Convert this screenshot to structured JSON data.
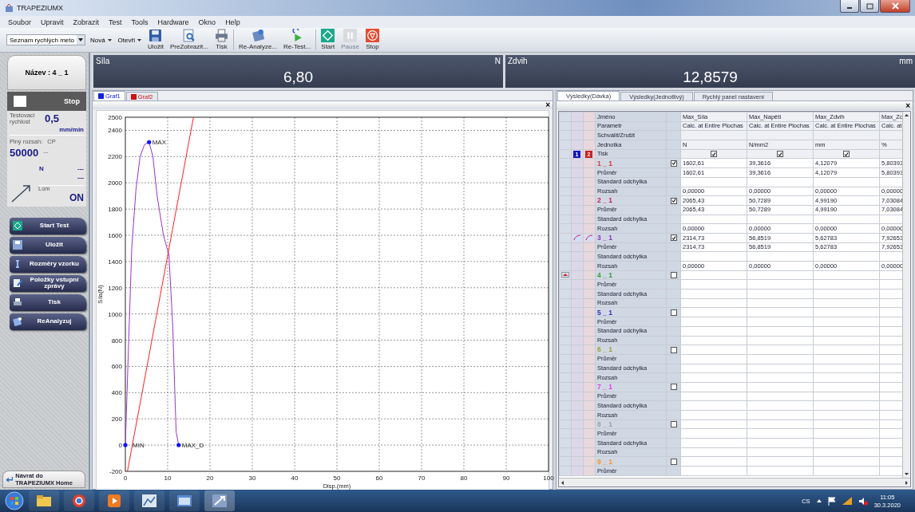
{
  "window": {
    "title": "TRAPEZIUMX"
  },
  "menu": [
    "Soubor",
    "Upravit",
    "Zobrazit",
    "Test",
    "Tools",
    "Hardware",
    "Okno",
    "Help"
  ],
  "toolbar": {
    "quick_methods": "Seznam rychlých meto",
    "menus": [
      "Nová",
      "Otevři"
    ],
    "buttons": [
      {
        "label": "Uložit",
        "kind": "save",
        "disabled": false
      },
      {
        "label": "PreZobrazit...",
        "kind": "preview",
        "disabled": false
      },
      {
        "label": "Tisk",
        "kind": "print",
        "disabled": false
      },
      {
        "label": "Re-Analyze...",
        "kind": "reanalyze",
        "disabled": false
      },
      {
        "label": "Re-Test...",
        "kind": "retest",
        "disabled": false
      },
      {
        "label": "Start",
        "kind": "start",
        "disabled": false
      },
      {
        "label": "Pause",
        "kind": "pause",
        "disabled": true
      },
      {
        "label": "Stop",
        "kind": "stop",
        "disabled": false
      }
    ]
  },
  "left_panel": {
    "name": "Název : 4 _ 1",
    "status": "Stop",
    "speed": {
      "label": "Testovací rychlost",
      "value": "0,5",
      "unit": "mm/min"
    },
    "range": {
      "label": "Plný rozsah:",
      "mode": "CP",
      "mode_reading": "---",
      "value": "50000",
      "unit": "N",
      "reading": "---",
      "reading_unit": "—"
    },
    "break": {
      "label": "Lom",
      "value": "ON"
    },
    "actions": [
      {
        "label": "Start Test",
        "kind": "start"
      },
      {
        "label": "Uložit",
        "kind": "save"
      },
      {
        "label": "Rozměry vzorku",
        "kind": "dimensions"
      },
      {
        "label": "Položky vstupní zprávy",
        "kind": "report"
      },
      {
        "label": "Tisk",
        "kind": "print"
      },
      {
        "label": "ReAnalyzuj",
        "kind": "reanalyze"
      }
    ],
    "home": "Návrat do TRAPEZIUMX Home"
  },
  "readouts": [
    {
      "label": "Síla",
      "unit": "N",
      "value": "6,80"
    },
    {
      "label": "Zdvih",
      "unit": "mm",
      "value": "12,8579"
    }
  ],
  "graph": {
    "tabs": [
      {
        "label": "Graf1",
        "color": "#1020e0",
        "selected": true
      },
      {
        "label": "Graf2",
        "color": "#d01010",
        "selected": false
      }
    ],
    "close": "×",
    "chart_data": {
      "type": "line",
      "grid": true,
      "xlabel": "Disp.(mm)",
      "ylabel": "Síla(N)",
      "xlim": [
        0,
        100
      ],
      "ylim": [
        -200,
        2500
      ],
      "xticks": [
        0,
        10,
        20,
        30,
        40,
        50,
        60,
        70,
        80,
        90,
        100
      ],
      "yticks": [
        -200,
        0,
        200,
        400,
        600,
        800,
        1000,
        1200,
        1400,
        1600,
        1800,
        2000,
        2200,
        2400,
        2500
      ],
      "series": [
        {
          "color": "#9933cc",
          "x": [
            0,
            0.8,
            1.5,
            2.5,
            3.5,
            4.5,
            5.6,
            6.5,
            7.5,
            9,
            10.3,
            11.2,
            11.8,
            12,
            12.6
          ],
          "values": [
            0,
            800,
            1500,
            1950,
            2200,
            2290,
            2310,
            2200,
            1900,
            1600,
            1450,
            900,
            300,
            100,
            0
          ]
        },
        {
          "color": "#ff2020",
          "x": [
            0.5,
            16.1
          ],
          "values": [
            -200,
            2500
          ]
        }
      ],
      "annotations": [
        "MIN",
        "MAX",
        "MAX_D"
      ]
    }
  },
  "results": {
    "tabs": [
      {
        "label": "Výsledky(Dávka)",
        "selected": true
      },
      {
        "label": "Výsledky(Jednotlivý)",
        "selected": false
      },
      {
        "label": "Rychlý panel nastavení",
        "selected": false
      }
    ],
    "close": "×",
    "header_labels": [
      "Jméno",
      "Parametr",
      "Schválit/Zrušit",
      "Jednotka",
      "Tisk"
    ],
    "legend": [
      {
        "text": "1",
        "color": "#1414c8"
      },
      {
        "text": "2",
        "color": "#d02020"
      }
    ],
    "columns": [
      {
        "name": "Max_Síla",
        "parameter": "Calc. at Entire Plochas",
        "unit": "N",
        "print": true
      },
      {
        "name": "Max_Napětí",
        "parameter": "Calc. at Entire Plochas",
        "unit": "N/mm2",
        "print": true
      },
      {
        "name": "Max_Zdvih",
        "parameter": "Calc. at Entire Plochas",
        "unit": "mm",
        "print": true
      },
      {
        "name": "Max_Zd",
        "parameter": "Calc. at",
        "unit": "%"
      }
    ],
    "specimens": [
      {
        "name": "1 _ 1",
        "color": "#e03535",
        "checked": true,
        "plotted": false,
        "current": false,
        "values": [
          "1602,61",
          "39,3616",
          "4,12079",
          "5,80393"
        ],
        "stats": [
          {
            "label": "Průměr",
            "values": [
              "1602,61",
              "39,3616",
              "4,12079",
              "5,80393"
            ]
          },
          {
            "label": "Standard odchylka"
          },
          {
            "label": "Rozsah",
            "values": [
              "0,00000",
              "0,00000",
              "0,00000",
              "0,00000"
            ]
          }
        ]
      },
      {
        "name": "2 _ 1",
        "color": "#c81e5a",
        "checked": true,
        "plotted": false,
        "current": false,
        "values": [
          "2065,43",
          "50,7289",
          "4,99190",
          "7,03084"
        ],
        "stats": [
          {
            "label": "Průměr",
            "values": [
              "2065,43",
              "50,7289",
              "4,99190",
              "7,03084"
            ]
          },
          {
            "label": "Standard odchylka"
          },
          {
            "label": "Rozsah",
            "values": [
              "0,00000",
              "0,00000",
              "0,00000",
              "0,00000"
            ]
          }
        ]
      },
      {
        "name": "3 _ 1",
        "color": "#9030c0",
        "checked": true,
        "plotted": true,
        "current": false,
        "values": [
          "2314,73",
          "56,8519",
          "5,62783",
          "7,92653"
        ],
        "stats": [
          {
            "label": "Průměr",
            "values": [
              "2314,73",
              "56,8519",
              "5,62783",
              "7,92653"
            ]
          },
          {
            "label": "Standard odchylka"
          },
          {
            "label": "Rozsah",
            "values": [
              "0,00000",
              "0,00000",
              "0,00000",
              "0,00000"
            ]
          }
        ]
      },
      {
        "name": "4 _ 1",
        "color": "#30a030",
        "checked": false,
        "plotted": false,
        "current": true,
        "stats": [
          {
            "label": "Průměr"
          },
          {
            "label": "Standard odchylka"
          },
          {
            "label": "Rozsah"
          }
        ]
      },
      {
        "name": "5 _ 1",
        "color": "#3030c0",
        "checked": false,
        "plotted": false,
        "current": false,
        "stats": [
          {
            "label": "Průměr"
          },
          {
            "label": "Standard odchylka"
          },
          {
            "label": "Rozsah"
          }
        ]
      },
      {
        "name": "6 _ 1",
        "color": "#a0a030",
        "checked": false,
        "plotted": false,
        "current": false,
        "stats": [
          {
            "label": "Průměr"
          },
          {
            "label": "Standard odchylka"
          },
          {
            "label": "Rozsah"
          }
        ]
      },
      {
        "name": "7 _ 1",
        "color": "#f030f0",
        "checked": false,
        "plotted": false,
        "current": false,
        "stats": [
          {
            "label": "Průměr"
          },
          {
            "label": "Standard odchylka"
          },
          {
            "label": "Rozsah"
          }
        ]
      },
      {
        "name": "8 _ 1",
        "color": "#a0a0a0",
        "checked": false,
        "plotted": false,
        "current": false,
        "stats": [
          {
            "label": "Průměr"
          },
          {
            "label": "Standard odchylka"
          },
          {
            "label": "Rozsah"
          }
        ]
      },
      {
        "name": "9 _ 1",
        "color": "#ff9020",
        "checked": false,
        "plotted": false,
        "current": false,
        "stats": [
          {
            "label": "Průměr"
          }
        ]
      }
    ]
  },
  "taskbar": {
    "language": "CS",
    "time": "11:05",
    "date": "30.3.2020"
  }
}
